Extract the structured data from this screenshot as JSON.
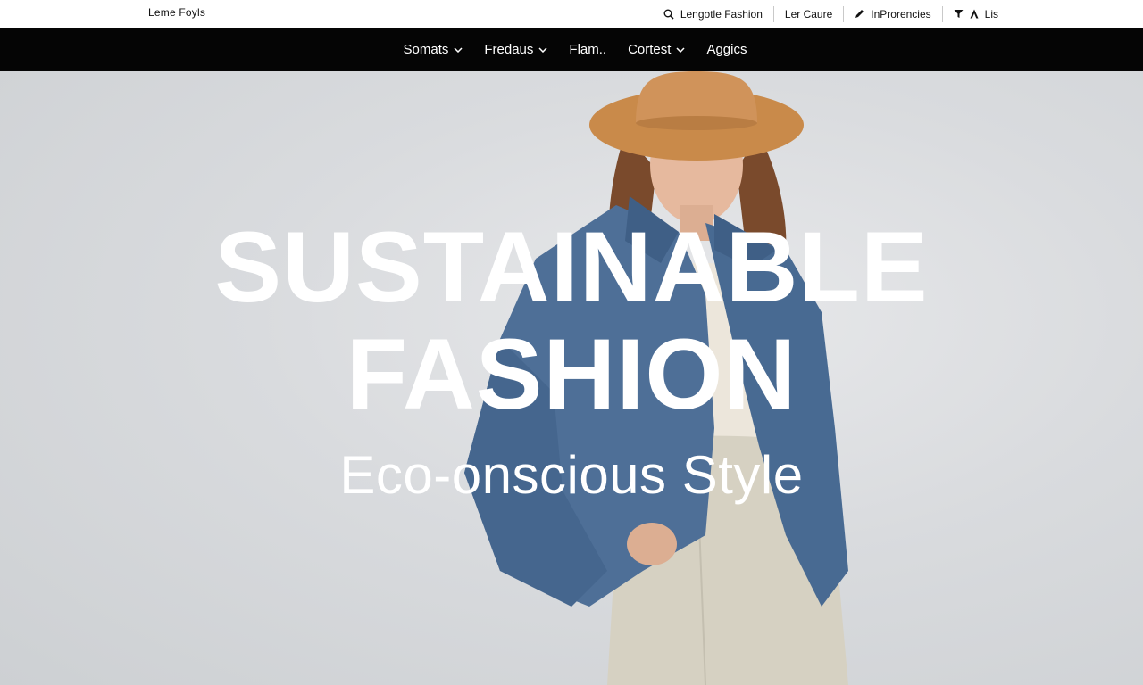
{
  "brand": {
    "name": "Leme Foyls"
  },
  "utility": {
    "search_label": "Lengotle Fashion",
    "link_2": "Ler Caure",
    "link_3": "InProrencies",
    "link_4": "Lis"
  },
  "nav": {
    "items": [
      {
        "label": "Somats",
        "icon": "chevron-down-icon"
      },
      {
        "label": "Fredaus",
        "icon": "chevron-down-icon"
      },
      {
        "label": "Flam..",
        "icon": ""
      },
      {
        "label": "Cortest",
        "icon": "chevron-down-icon"
      },
      {
        "label": "Aggics",
        "icon": ""
      }
    ]
  },
  "hero": {
    "line1": "SUSTAINABLE",
    "line2": "FASHION",
    "line3": "Eco-onscious Style"
  },
  "colors": {
    "nav_bg": "#050505",
    "hero_bg": "#d9dbde",
    "hat": "#c98a4a",
    "jacket": "#4e6f97",
    "skirt": "#d6d1c2"
  }
}
